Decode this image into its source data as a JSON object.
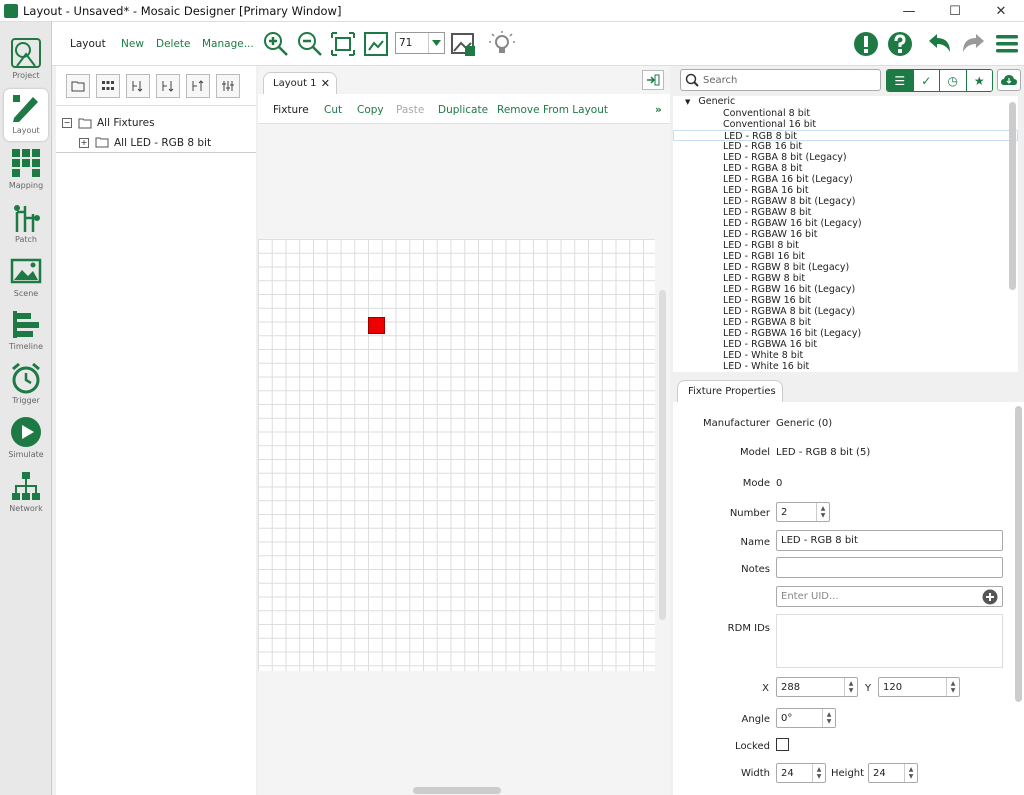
{
  "window": {
    "title": "Layout - Unsaved* - Mosaic Designer [Primary Window]"
  },
  "nav": [
    {
      "label": "Project",
      "icon": "project-icon"
    },
    {
      "label": "Layout",
      "icon": "layout-icon"
    },
    {
      "label": "Mapping",
      "icon": "mapping-icon"
    },
    {
      "label": "Patch",
      "icon": "patch-icon"
    },
    {
      "label": "Scene",
      "icon": "scene-icon"
    },
    {
      "label": "Timeline",
      "icon": "timeline-icon"
    },
    {
      "label": "Trigger",
      "icon": "trigger-icon"
    },
    {
      "label": "Simulate",
      "icon": "simulate-icon"
    },
    {
      "label": "Network",
      "icon": "network-icon"
    }
  ],
  "toolbar": {
    "layout_label": "Layout",
    "new_label": "New",
    "delete_label": "Delete",
    "manage_label": "Manage...",
    "zoom_value": "71"
  },
  "fixtures": {
    "root": "All Fixtures",
    "child": "All LED - RGB 8 bit"
  },
  "canvas": {
    "tab": "Layout 1",
    "actions": {
      "fixture": "Fixture",
      "cut": "Cut",
      "copy": "Copy",
      "paste": "Paste",
      "duplicate": "Duplicate",
      "remove": "Remove From Layout"
    }
  },
  "library": {
    "search_placeholder": "Search",
    "group": "Generic",
    "items": [
      "Conventional 8 bit",
      "Conventional 16 bit",
      "LED - RGB 8 bit",
      "LED - RGB 16 bit",
      "LED - RGBA 8 bit (Legacy)",
      "LED - RGBA 8 bit",
      "LED - RGBA 16 bit (Legacy)",
      "LED - RGBA 16 bit",
      "LED - RGBAW 8 bit (Legacy)",
      "LED - RGBAW 8 bit",
      "LED - RGBAW 16 bit (Legacy)",
      "LED - RGBAW 16 bit",
      "LED - RGBI 8 bit",
      "LED - RGBI 16 bit",
      "LED - RGBW 8 bit (Legacy)",
      "LED - RGBW 8 bit",
      "LED - RGBW 16 bit (Legacy)",
      "LED - RGBW 16 bit",
      "LED - RGBWA 8 bit (Legacy)",
      "LED - RGBWA 8 bit",
      "LED - RGBWA 16 bit (Legacy)",
      "LED - RGBWA 16 bit",
      "LED - White 8 bit",
      "LED - White 16 bit"
    ],
    "selected": "LED - RGB 8 bit"
  },
  "properties": {
    "tab": "Fixture Properties",
    "manufacturer_label": "Manufacturer",
    "manufacturer": "Generic (0)",
    "model_label": "Model",
    "model": "LED - RGB 8 bit (5)",
    "mode_label": "Mode",
    "mode": "0",
    "number_label": "Number",
    "number": "2",
    "name_label": "Name",
    "name": "LED - RGB 8 bit",
    "notes_label": "Notes",
    "notes": "",
    "uid_placeholder": "Enter UID...",
    "rdm_label": "RDM IDs",
    "x_label": "X",
    "x": "288",
    "y_label": "Y",
    "y": "120",
    "angle_label": "Angle",
    "angle": "0°",
    "locked_label": "Locked",
    "width_label": "Width",
    "width": "24",
    "height_label": "Height",
    "height": "24"
  },
  "colors": {
    "accent": "#1e7a45",
    "fixture": "#ee0000"
  }
}
